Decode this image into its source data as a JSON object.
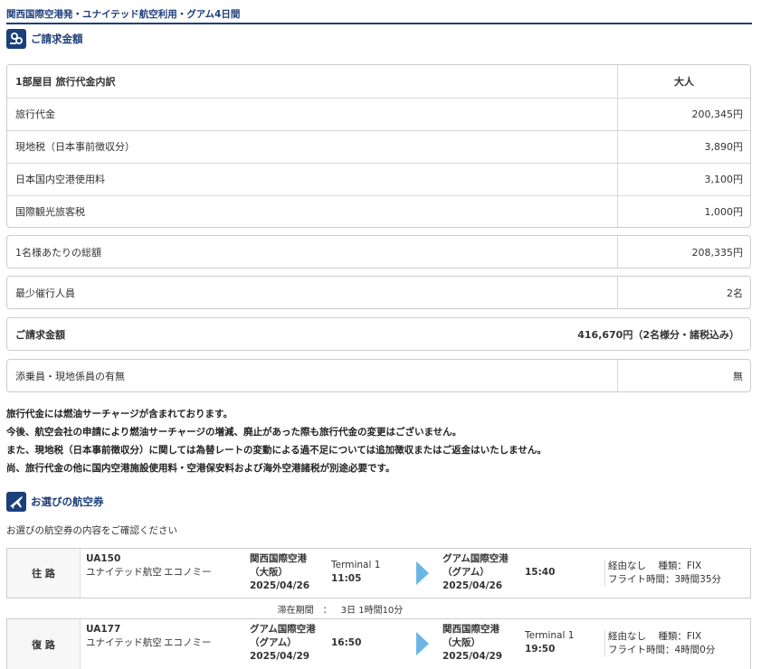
{
  "header": {
    "title": "関西国際空港発・ユナイテッド航空利用・グアム4日間"
  },
  "billing": {
    "section_title": "ご請求金額",
    "table_header": {
      "label": "1部屋目 旅行代金内訳",
      "column": "大人"
    },
    "rows": [
      {
        "label": "旅行代金",
        "value": "200,345円"
      },
      {
        "label": "現地税（日本事前徴収分）",
        "value": "3,890円"
      },
      {
        "label": "日本国内空港使用料",
        "value": "3,100円"
      },
      {
        "label": "国際観光旅客税",
        "value": "1,000円"
      }
    ],
    "per_person": {
      "label": "1名様あたりの総額",
      "value": "208,335円"
    },
    "min_travelers": {
      "label": "最少催行人員",
      "value": "2名"
    },
    "total": {
      "label": "ご請求金額",
      "value": "416,670円（2名様分・諸税込み）"
    },
    "escort": {
      "label": "添乗員・現地係員の有無",
      "value": "無"
    }
  },
  "notes": [
    "旅行代金には燃油サーチャージが含まれております。",
    "今後、航空会社の申請により燃油サーチャージの増減、廃止があった際も旅行代金の変更はございません。",
    "また、現地税（日本事前徴収分）に関しては為替レートの変動による過不足については追加徴収またはご返金はいたしません。",
    "尚、旅行代金の他に国内空港施設使用料・空港保安料および海外空港諸税が別途必要です。"
  ],
  "flights": {
    "section_title": "お選びの航空券",
    "intro": "お選びの航空券の内容をご確認ください",
    "outbound": {
      "direction": "往 路",
      "flight_no": "UA150",
      "airline": "ユナイテッド航空",
      "class": "エコノミー",
      "dep_airport": "関西国際空港（大阪）",
      "dep_date": "2025/04/26",
      "dep_terminal": "Terminal 1",
      "dep_time": "11:05",
      "arr_airport": "グアム国際空港（グアム）",
      "arr_date": "2025/04/26",
      "arr_time": "15:40",
      "route": "経由なし",
      "type": "種類：FIX",
      "duration": "フライト時間：3時間35分"
    },
    "stay": {
      "label": "滞在期間",
      "sep": "：",
      "value": "3日 1時間10分"
    },
    "return": {
      "direction": "復 路",
      "flight_no": "UA177",
      "airline": "ユナイテッド航空",
      "class": "エコノミー",
      "dep_airport": "グアム国際空港（グアム）",
      "dep_date": "2025/04/29",
      "dep_time": "16:50",
      "arr_airport": "関西国際空港（大阪）",
      "arr_date": "2025/04/29",
      "arr_terminal": "Terminal 1",
      "arr_time": "19:50",
      "route": "経由なし",
      "type": "種類：FIX",
      "duration": "フライト時間：4時間0分"
    }
  },
  "colors": {
    "brand": "#1e3f7a",
    "arrow": "#6ab5e6",
    "border": "#cccccc"
  }
}
